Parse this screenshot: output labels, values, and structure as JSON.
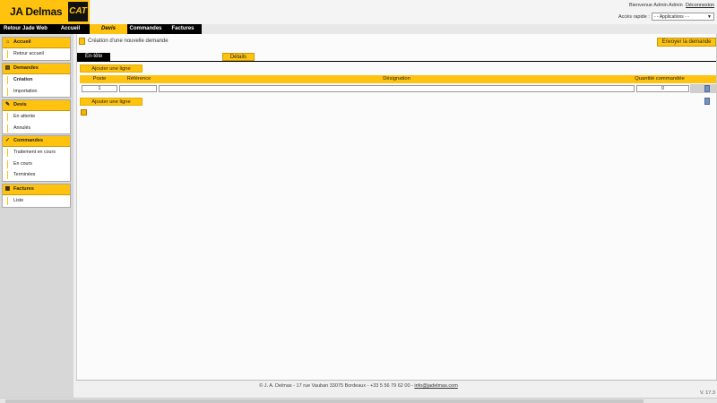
{
  "header": {
    "brand": "JA Delmas",
    "cat_logo": "CAT",
    "welcome": "Bienvenue Admin Admin",
    "logout": "Déconnexion",
    "quick_access_label": "Accès rapide :",
    "quick_access_value": "- - Applications - -"
  },
  "nav": {
    "tabs": [
      {
        "label": "Retour Jade Web"
      },
      {
        "label": "Accueil"
      },
      {
        "label": "Devis",
        "active": true
      },
      {
        "label": "Commandes"
      },
      {
        "label": "Factures"
      }
    ]
  },
  "sidebar": {
    "groups": [
      {
        "title": "Accueil",
        "items": [
          {
            "label": "Retour accueil"
          }
        ]
      },
      {
        "title": "Demandes",
        "items": [
          {
            "label": "Création",
            "active": true
          },
          {
            "label": "Importation"
          }
        ]
      },
      {
        "title": "Devis",
        "items": [
          {
            "label": "En attente"
          },
          {
            "label": "Annulés"
          }
        ]
      },
      {
        "title": "Commandes",
        "items": [
          {
            "label": "Traitement en cours"
          },
          {
            "label": "En cours"
          },
          {
            "label": "Terminées"
          }
        ]
      },
      {
        "title": "Factures",
        "items": [
          {
            "label": "Liste"
          }
        ]
      }
    ]
  },
  "main": {
    "title": "Création d'une nouvelle demande",
    "send_button": "Envoyer la demande",
    "tabs": [
      {
        "label": "En-tête"
      },
      {
        "label": "Détails",
        "active": true
      }
    ],
    "add_line": "Ajouter une ligne",
    "table": {
      "columns": [
        "Poste",
        "Référence",
        "Désignation",
        "Quantité commandée"
      ],
      "rows": [
        {
          "poste": "1",
          "reference": "",
          "designation": "",
          "quantite": "0"
        }
      ]
    }
  },
  "footer": {
    "text": "© J. A. Delmas - 17 rue Vauban 33075 Bordeaux - +33 5 56 79 62 00 -",
    "email": "info@jadelmas.com",
    "version": "V. 17.3"
  },
  "colors": {
    "accent": "#ffc20e",
    "dark": "#000000"
  }
}
